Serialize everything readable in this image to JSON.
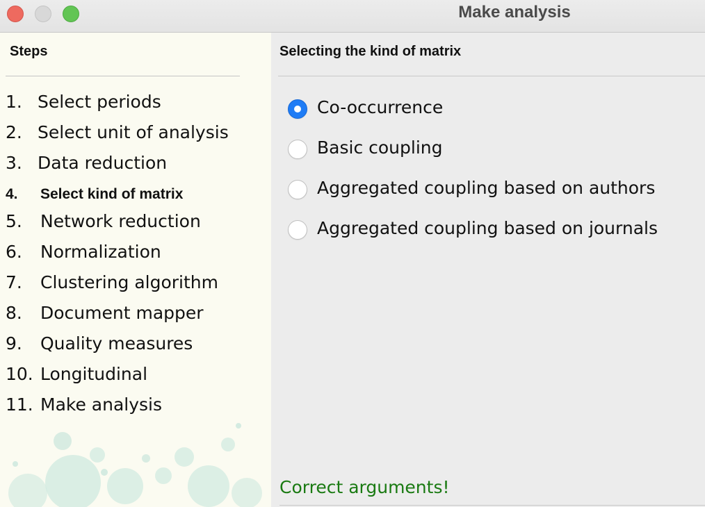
{
  "window": {
    "title": "Make analysis"
  },
  "steps": {
    "header": "Steps",
    "active_index": 3,
    "items": [
      {
        "num": "1.",
        "label": "Select periods"
      },
      {
        "num": "2.",
        "label": "Select unit of analysis"
      },
      {
        "num": "3.",
        "label": "Data reduction"
      },
      {
        "num": "4.",
        "label": "Select kind of matrix"
      },
      {
        "num": "5.",
        "label": "Network reduction"
      },
      {
        "num": "6.",
        "label": "Normalization"
      },
      {
        "num": "7.",
        "label": "Clustering algorithm"
      },
      {
        "num": "8.",
        "label": "Document mapper"
      },
      {
        "num": "9.",
        "label": "Quality measures"
      },
      {
        "num": "10.",
        "label": "Longitudinal"
      },
      {
        "num": "11.",
        "label": "Make analysis"
      }
    ]
  },
  "content": {
    "header": "Selecting the kind of matrix",
    "options": [
      {
        "label": "Co-occurrence",
        "selected": true
      },
      {
        "label": "Basic coupling",
        "selected": false
      },
      {
        "label": "Aggregated coupling based on authors",
        "selected": false
      },
      {
        "label": "Aggregated coupling based on journals",
        "selected": false
      }
    ],
    "status": "Correct arguments!"
  },
  "colors": {
    "accent": "#1f7cf5",
    "status_ok": "#1a7a12",
    "steps_bg": "#fbfbf1",
    "bubbles": "#cfe9df"
  }
}
